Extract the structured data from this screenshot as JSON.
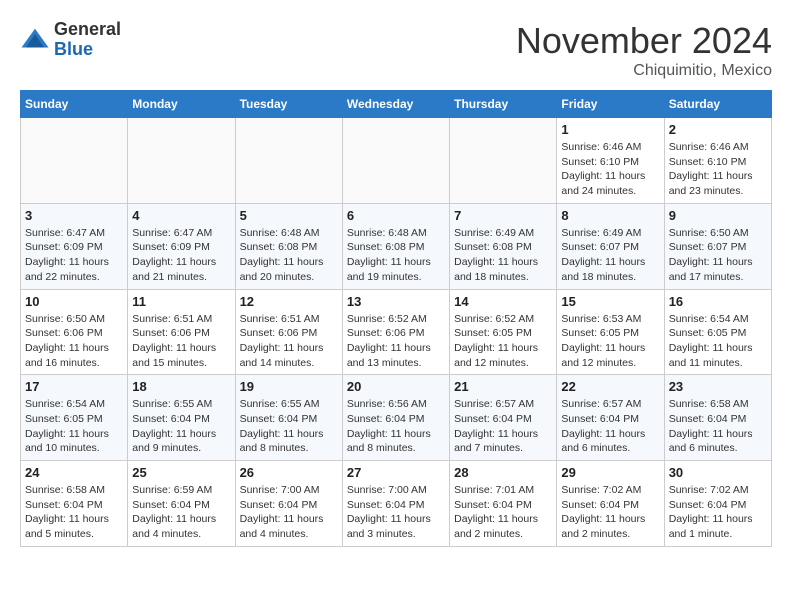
{
  "logo": {
    "general": "General",
    "blue": "Blue"
  },
  "header": {
    "month": "November 2024",
    "location": "Chiquimitio, Mexico"
  },
  "weekdays": [
    "Sunday",
    "Monday",
    "Tuesday",
    "Wednesday",
    "Thursday",
    "Friday",
    "Saturday"
  ],
  "weeks": [
    [
      {
        "day": "",
        "info": ""
      },
      {
        "day": "",
        "info": ""
      },
      {
        "day": "",
        "info": ""
      },
      {
        "day": "",
        "info": ""
      },
      {
        "day": "",
        "info": ""
      },
      {
        "day": "1",
        "info": "Sunrise: 6:46 AM\nSunset: 6:10 PM\nDaylight: 11 hours and 24 minutes."
      },
      {
        "day": "2",
        "info": "Sunrise: 6:46 AM\nSunset: 6:10 PM\nDaylight: 11 hours and 23 minutes."
      }
    ],
    [
      {
        "day": "3",
        "info": "Sunrise: 6:47 AM\nSunset: 6:09 PM\nDaylight: 11 hours and 22 minutes."
      },
      {
        "day": "4",
        "info": "Sunrise: 6:47 AM\nSunset: 6:09 PM\nDaylight: 11 hours and 21 minutes."
      },
      {
        "day": "5",
        "info": "Sunrise: 6:48 AM\nSunset: 6:08 PM\nDaylight: 11 hours and 20 minutes."
      },
      {
        "day": "6",
        "info": "Sunrise: 6:48 AM\nSunset: 6:08 PM\nDaylight: 11 hours and 19 minutes."
      },
      {
        "day": "7",
        "info": "Sunrise: 6:49 AM\nSunset: 6:08 PM\nDaylight: 11 hours and 18 minutes."
      },
      {
        "day": "8",
        "info": "Sunrise: 6:49 AM\nSunset: 6:07 PM\nDaylight: 11 hours and 18 minutes."
      },
      {
        "day": "9",
        "info": "Sunrise: 6:50 AM\nSunset: 6:07 PM\nDaylight: 11 hours and 17 minutes."
      }
    ],
    [
      {
        "day": "10",
        "info": "Sunrise: 6:50 AM\nSunset: 6:06 PM\nDaylight: 11 hours and 16 minutes."
      },
      {
        "day": "11",
        "info": "Sunrise: 6:51 AM\nSunset: 6:06 PM\nDaylight: 11 hours and 15 minutes."
      },
      {
        "day": "12",
        "info": "Sunrise: 6:51 AM\nSunset: 6:06 PM\nDaylight: 11 hours and 14 minutes."
      },
      {
        "day": "13",
        "info": "Sunrise: 6:52 AM\nSunset: 6:06 PM\nDaylight: 11 hours and 13 minutes."
      },
      {
        "day": "14",
        "info": "Sunrise: 6:52 AM\nSunset: 6:05 PM\nDaylight: 11 hours and 12 minutes."
      },
      {
        "day": "15",
        "info": "Sunrise: 6:53 AM\nSunset: 6:05 PM\nDaylight: 11 hours and 12 minutes."
      },
      {
        "day": "16",
        "info": "Sunrise: 6:54 AM\nSunset: 6:05 PM\nDaylight: 11 hours and 11 minutes."
      }
    ],
    [
      {
        "day": "17",
        "info": "Sunrise: 6:54 AM\nSunset: 6:05 PM\nDaylight: 11 hours and 10 minutes."
      },
      {
        "day": "18",
        "info": "Sunrise: 6:55 AM\nSunset: 6:04 PM\nDaylight: 11 hours and 9 minutes."
      },
      {
        "day": "19",
        "info": "Sunrise: 6:55 AM\nSunset: 6:04 PM\nDaylight: 11 hours and 8 minutes."
      },
      {
        "day": "20",
        "info": "Sunrise: 6:56 AM\nSunset: 6:04 PM\nDaylight: 11 hours and 8 minutes."
      },
      {
        "day": "21",
        "info": "Sunrise: 6:57 AM\nSunset: 6:04 PM\nDaylight: 11 hours and 7 minutes."
      },
      {
        "day": "22",
        "info": "Sunrise: 6:57 AM\nSunset: 6:04 PM\nDaylight: 11 hours and 6 minutes."
      },
      {
        "day": "23",
        "info": "Sunrise: 6:58 AM\nSunset: 6:04 PM\nDaylight: 11 hours and 6 minutes."
      }
    ],
    [
      {
        "day": "24",
        "info": "Sunrise: 6:58 AM\nSunset: 6:04 PM\nDaylight: 11 hours and 5 minutes."
      },
      {
        "day": "25",
        "info": "Sunrise: 6:59 AM\nSunset: 6:04 PM\nDaylight: 11 hours and 4 minutes."
      },
      {
        "day": "26",
        "info": "Sunrise: 7:00 AM\nSunset: 6:04 PM\nDaylight: 11 hours and 4 minutes."
      },
      {
        "day": "27",
        "info": "Sunrise: 7:00 AM\nSunset: 6:04 PM\nDaylight: 11 hours and 3 minutes."
      },
      {
        "day": "28",
        "info": "Sunrise: 7:01 AM\nSunset: 6:04 PM\nDaylight: 11 hours and 2 minutes."
      },
      {
        "day": "29",
        "info": "Sunrise: 7:02 AM\nSunset: 6:04 PM\nDaylight: 11 hours and 2 minutes."
      },
      {
        "day": "30",
        "info": "Sunrise: 7:02 AM\nSunset: 6:04 PM\nDaylight: 11 hours and 1 minute."
      }
    ]
  ]
}
